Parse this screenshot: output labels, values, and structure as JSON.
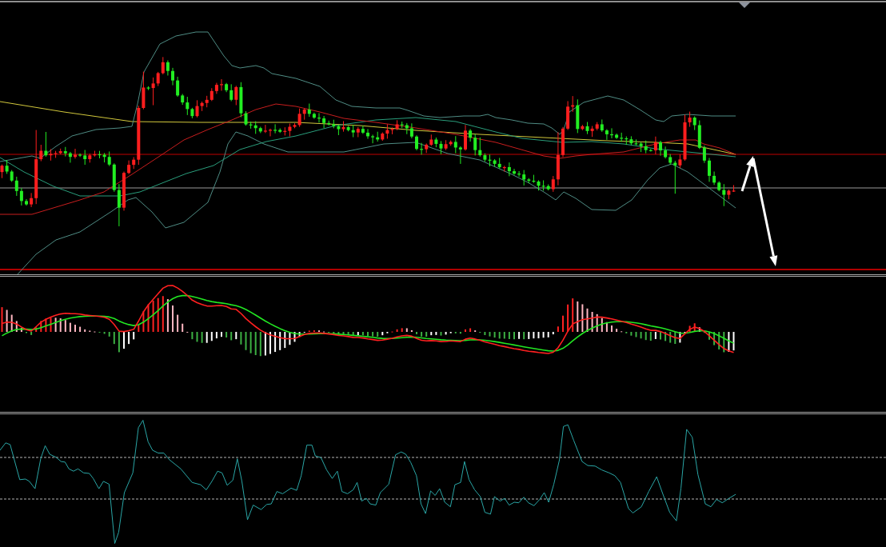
{
  "panels": [
    {
      "kind": "price"
    },
    {
      "kind": "macd"
    },
    {
      "kind": "oscillator"
    }
  ]
}
